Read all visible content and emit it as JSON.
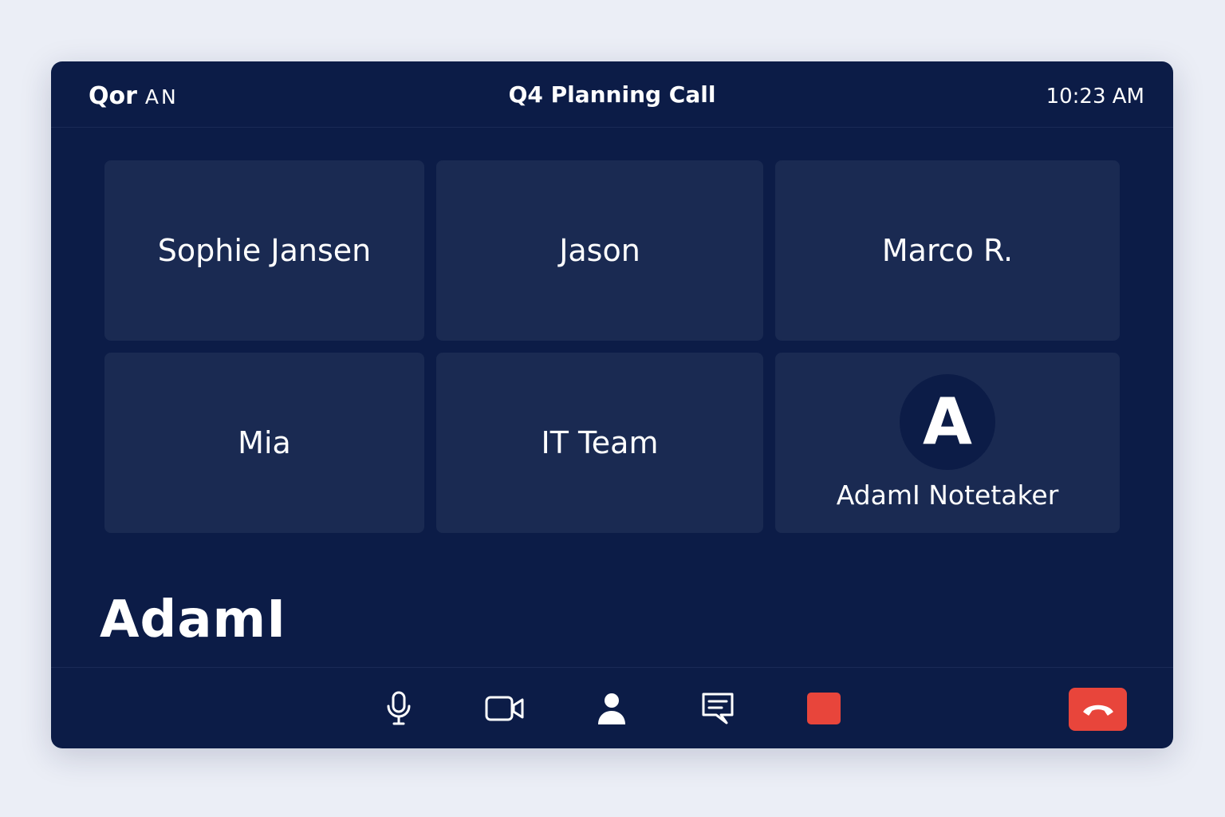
{
  "header": {
    "brand": "Qor",
    "brand_sub": "AN",
    "title": "Q4 Planning Call",
    "time": "10:23 AM"
  },
  "participants": [
    {
      "name": "Sophie Jansen"
    },
    {
      "name": "Jason"
    },
    {
      "name": "Marco R."
    },
    {
      "name": "Mia"
    },
    {
      "name": "IT Team"
    },
    {
      "name": "AdamI Notetaker",
      "avatar_letter": "A"
    }
  ],
  "logo": {
    "text": "AdamI"
  },
  "toolbar": {
    "icons": [
      "microphone-icon",
      "video-camera-icon",
      "person-icon",
      "chat-icon",
      "record-icon",
      "end-call-icon"
    ]
  },
  "colors": {
    "background": "#ebeef6",
    "panel": "#0c1c47",
    "tile": "#1a2a52",
    "accent_red": "#e8453b",
    "text": "#ffffff"
  }
}
